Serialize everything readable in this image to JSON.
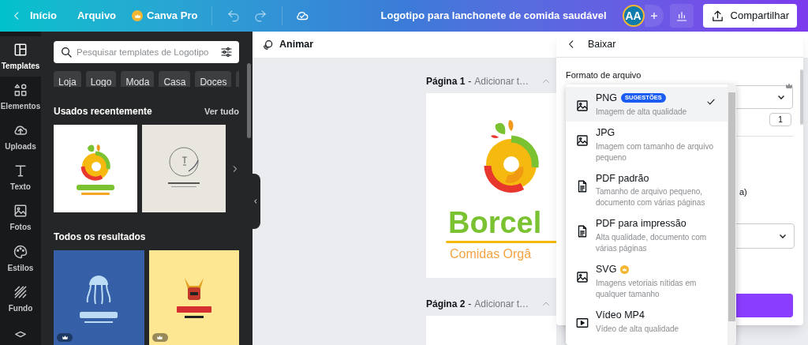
{
  "topbar": {
    "home": "Início",
    "file": "Arquivo",
    "pro": "Canva Pro",
    "title": "Logotipo para lanchonete de comida saudável",
    "avatar": "AA",
    "share": "Compartilhar"
  },
  "rail": [
    {
      "label": "Templates",
      "selected": true
    },
    {
      "label": "Elementos",
      "selected": false
    },
    {
      "label": "Uploads",
      "selected": false
    },
    {
      "label": "Texto",
      "selected": false
    },
    {
      "label": "Fotos",
      "selected": false
    },
    {
      "label": "Estilos",
      "selected": false
    },
    {
      "label": "Fundo",
      "selected": false
    }
  ],
  "panel": {
    "search": {
      "placeholder": "Pesquisar templates de Logotipo"
    },
    "chips": [
      "Loja",
      "Logo",
      "Moda",
      "Casa",
      "Doces"
    ],
    "recent": {
      "title": "Usados recentemente",
      "link": "Ver tudo",
      "thumbs": [
        {
          "kind": "fruit"
        },
        {
          "kind": "wreath"
        }
      ]
    },
    "results": {
      "title": "Todos os resultados",
      "thumbs": [
        {
          "kind": "jellyfish",
          "premium": true
        },
        {
          "kind": "samurai",
          "premium": true
        }
      ]
    }
  },
  "toolbar": {
    "animate": "Animar"
  },
  "pages": [
    {
      "label": "Página 1",
      "separator": "-",
      "title": "Adicionar t…",
      "brand": "Borcel",
      "tagline": "Comidas Orgâ"
    },
    {
      "label": "Página 2",
      "separator": "-",
      "title": "Adicionar t…"
    }
  ],
  "download": {
    "title": "Baixar",
    "section": "Formato de arquivo",
    "quantity": "1",
    "partial_label": "a)",
    "formats": [
      {
        "name": "PNG",
        "badge": "SUGESTÕES",
        "pro": false,
        "kind": "image",
        "description": "Imagem de alta qualidade",
        "selected": true
      },
      {
        "name": "JPG",
        "pro": false,
        "kind": "image",
        "description": "Imagem com tamanho de arquivo pequeno",
        "selected": false
      },
      {
        "name": "PDF padrão",
        "pro": false,
        "kind": "document",
        "description": "Tamanho de arquivo pequeno, documento com várias páginas",
        "selected": false
      },
      {
        "name": "PDF para impressão",
        "pro": false,
        "kind": "document",
        "description": "Alta qualidade, documento com várias páginas",
        "selected": false
      },
      {
        "name": "SVG",
        "pro": true,
        "kind": "image",
        "description": "Imagens vetoriais nítidas em qualquer tamanho",
        "selected": false
      },
      {
        "name": "Vídeo MP4",
        "pro": false,
        "kind": "video",
        "description": "Vídeo de alta qualidade",
        "selected": false
      }
    ]
  }
}
